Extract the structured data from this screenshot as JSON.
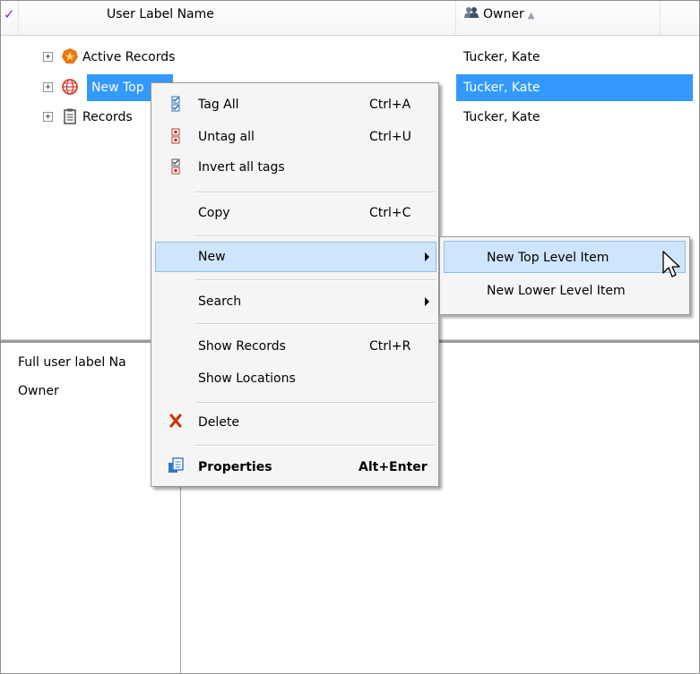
{
  "header": {
    "check_glyph": "✓",
    "name_col": "User Label Name",
    "owner_col": "Owner",
    "sort_glyph": "▲"
  },
  "tree": {
    "rows": [
      {
        "expander": "+",
        "icon": "active-records-icon",
        "label": "Active Records",
        "owner": "Tucker, Kate"
      },
      {
        "expander": "+",
        "icon": "globe-icon",
        "label": "New Top",
        "owner": "Tucker, Kate"
      },
      {
        "expander": "+",
        "icon": "records-clipboard-icon",
        "label": "Records",
        "owner": "Tucker, Kate"
      }
    ]
  },
  "details": {
    "full_name_label": "Full user label Na",
    "owner_label": "Owner"
  },
  "context_menu": {
    "tag_all": "Tag All",
    "tag_all_sc": "Ctrl+A",
    "untag_all": "Untag all",
    "untag_all_sc": "Ctrl+U",
    "invert_tags": "Invert all tags",
    "copy": "Copy",
    "copy_sc": "Ctrl+C",
    "new": "New",
    "search": "Search",
    "show_records": "Show Records",
    "show_records_sc": "Ctrl+R",
    "show_locations": "Show Locations",
    "delete": "Delete",
    "properties": "Properties",
    "properties_sc": "Alt+Enter"
  },
  "submenu": {
    "new_top": "New Top Level Item",
    "new_lower": "New Lower Level Item"
  },
  "colors": {
    "selection": "#3399ff",
    "menu_highlight": "#cfe5fb",
    "check_purple": "#7a2fd0",
    "delete_red": "#cc3300"
  }
}
